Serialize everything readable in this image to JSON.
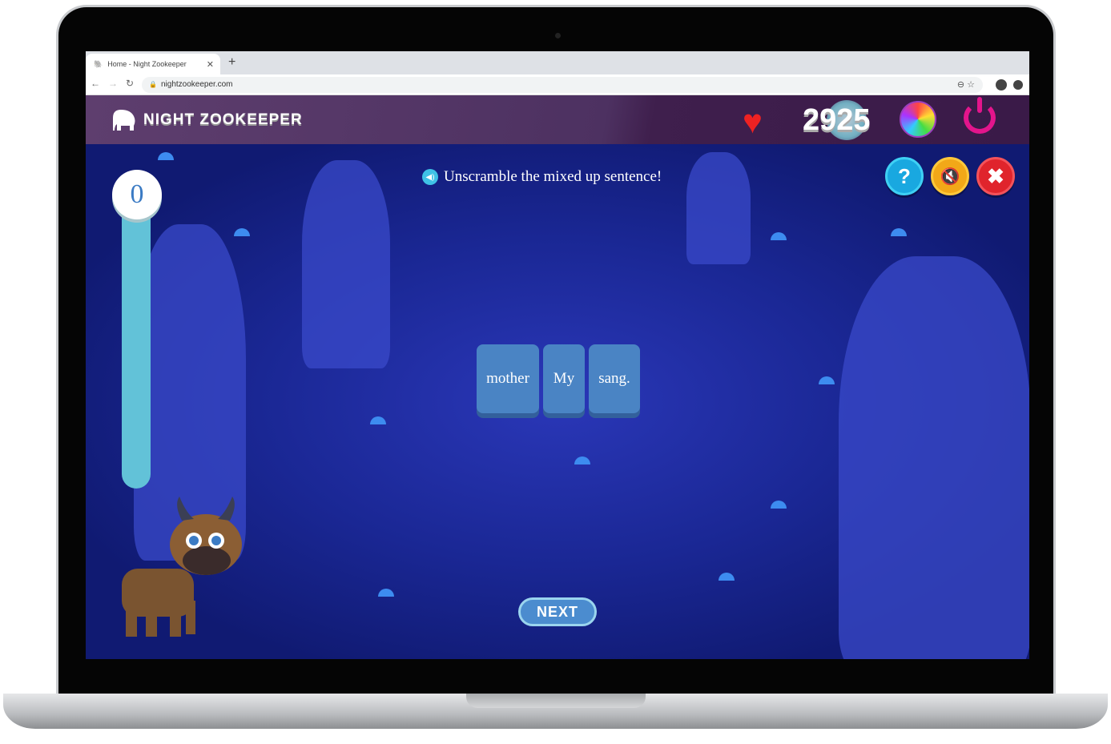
{
  "browser": {
    "tab_title": "Home - Night Zookeeper",
    "url": "nightzookeeper.com"
  },
  "header": {
    "logo_text": "NIGHT ZOOKEEPER",
    "score": "2925",
    "colors": {
      "heart": "#ee2222",
      "power": "#e3158c"
    }
  },
  "game": {
    "progress_count": "0",
    "instruction": "Unscramble the mixed up sentence!",
    "words": [
      "mother",
      "My",
      "sang."
    ],
    "next_label": "NEXT",
    "controls": {
      "help": "?",
      "mute": "🔇",
      "close": "✖"
    }
  }
}
